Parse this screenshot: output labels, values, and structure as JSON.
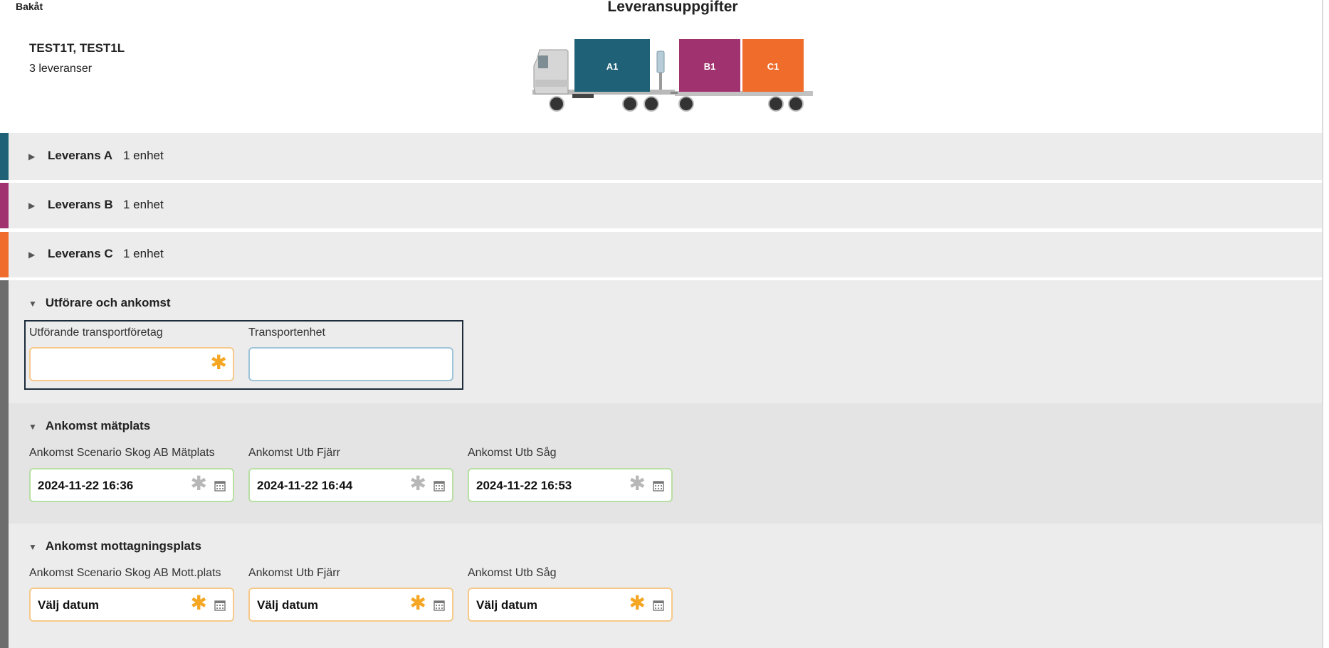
{
  "header": {
    "back_label": "Bakåt",
    "title": "Leveransuppgifter",
    "vehicle_names": "TEST1T, TEST1L",
    "delivery_count": "3 leveranser"
  },
  "truck": {
    "containers": [
      {
        "label": "A1",
        "color": "#1f6278"
      },
      {
        "label": "B1",
        "color": "#a0336f"
      },
      {
        "label": "C1",
        "color": "#ef6c2b"
      }
    ]
  },
  "deliveries": [
    {
      "label": "Leverans A",
      "units": "1 enhet",
      "color": "#1f6278"
    },
    {
      "label": "Leverans B",
      "units": "1 enhet",
      "color": "#a0336f"
    },
    {
      "label": "Leverans C",
      "units": "1 enhet",
      "color": "#ef6c2b"
    }
  ],
  "performer": {
    "heading": "Utförare och ankomst",
    "company_label": "Utförande transportföretag",
    "company_value": "",
    "unit_label": "Transportenhet",
    "unit_value": ""
  },
  "arrival_measure": {
    "heading": "Ankomst mätplats",
    "fields": [
      {
        "label": "Ankomst Scenario Skog AB Mätplats",
        "value": "2024-11-22 16:36"
      },
      {
        "label": "Ankomst Utb Fjärr",
        "value": "2024-11-22 16:44"
      },
      {
        "label": "Ankomst Utb Såg",
        "value": "2024-11-22 16:53"
      }
    ]
  },
  "arrival_receive": {
    "heading": "Ankomst mottagningsplats",
    "fields": [
      {
        "label": "Ankomst Scenario Skog AB Mott.plats",
        "value": "Välj datum"
      },
      {
        "label": "Ankomst Utb Fjärr",
        "value": "Välj datum"
      },
      {
        "label": "Ankomst Utb Såg",
        "value": "Välj datum"
      }
    ]
  },
  "icons": {
    "collapsed": "caret-right-icon",
    "expanded": "caret-down-icon",
    "required": "asterisk-icon",
    "calendar": "calendar-icon"
  }
}
